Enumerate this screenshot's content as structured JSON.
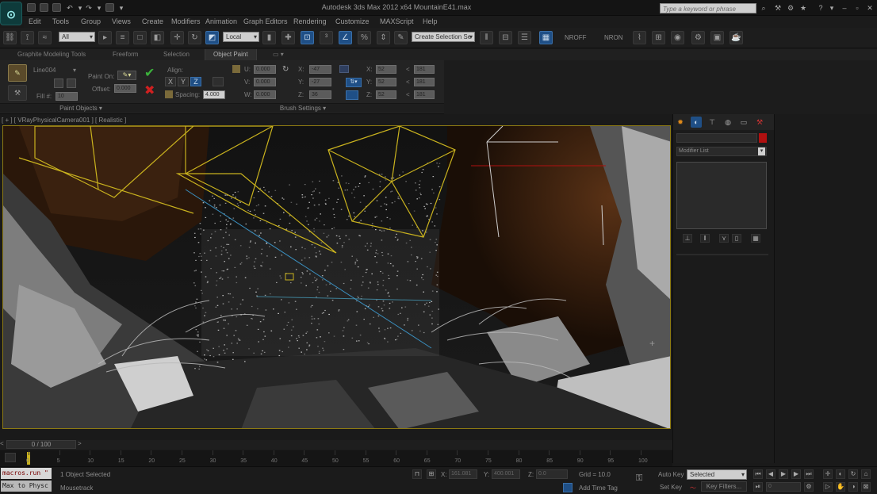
{
  "app": {
    "window_title": "Autodesk 3ds Max  2012 x64        MountainE41.max",
    "search_placeholder": "Type a keyword or phrase",
    "logo": "max-logo"
  },
  "menu": [
    "Edit",
    "Tools",
    "Group",
    "Views",
    "Create",
    "Modifiers",
    "Animation",
    "Graph Editors",
    "Rendering",
    "Customize",
    "MAXScript",
    "Help"
  ],
  "toolbar": {
    "selection_filter": "All",
    "reference_coord": "Local",
    "named_selection": "Create Selection Se",
    "nroff_label": "NROFF",
    "nron_label": "NRON"
  },
  "ribbon_tabs": [
    "Graphite Modeling Tools",
    "Freeform",
    "Selection",
    "Object Paint"
  ],
  "ribbon_active_tab": "Object Paint",
  "ribbon": {
    "object_name": "Line004",
    "paint_on_label": "Paint On:",
    "offset_label": "Offset:",
    "offset_value": "0.000",
    "fill_label": "Fill #:",
    "fill_value": "10",
    "align_label": "Align:",
    "axis_x": "X",
    "axis_y": "Y",
    "axis_z": "Z",
    "spacing_label": "Spacing:",
    "spacing_value": "4.000",
    "u_label": "U:",
    "v_label": "V:",
    "w_label": "W:",
    "u_value": "0.000",
    "v_value": "0.000",
    "w_value": "0.000",
    "rx_label": "X:",
    "ry_label": "Y:",
    "rz_label": "Z:",
    "rx_value": "-47",
    "ry_value": "-27",
    "rz_value": "36",
    "sx_label": "X:",
    "sy_label": "Y:",
    "sz_label": "Z:",
    "sx_value": "52",
    "sy_value": "52",
    "sz_value": "52",
    "ex_value": "181",
    "ey_value": "181",
    "ez_value": "181",
    "group_paint_objects": "Paint Objects",
    "group_brush_settings": "Brush Settings"
  },
  "viewport": {
    "label": "[ + ] [ VRayPhysicalCamera001 ] [ Realistic ]"
  },
  "command_panel": {
    "modifier_list": "Modifier List"
  },
  "timeline": {
    "frame_label": "0 / 100",
    "ticks": [
      "0",
      "5",
      "10",
      "15",
      "20",
      "25",
      "30",
      "35",
      "40",
      "45",
      "50",
      "55",
      "60",
      "65",
      "70",
      "75",
      "80",
      "85",
      "90",
      "95",
      "100"
    ]
  },
  "status": {
    "maxscript_line1": "macros.run \"",
    "maxscript_line2": "Max to Physc",
    "selection_status": "1 Object Selected",
    "prompt": "Mousetrack",
    "x_label": "X:",
    "x_value": "161.081",
    "y_label": "Y:",
    "y_value": "400.001",
    "z_label": "Z:",
    "z_value": "0.0",
    "grid": "Grid = 10.0",
    "add_time_tag": "Add Time Tag",
    "auto_key": "Auto Key",
    "set_key": "Set Key",
    "key_mode": "Selected",
    "key_filters": "Key Filters...",
    "frame_value": "0"
  },
  "colors": {
    "viewport_border": "#8d7a12",
    "accent_blue": "#1f4f86",
    "object_color": "#b01010"
  }
}
